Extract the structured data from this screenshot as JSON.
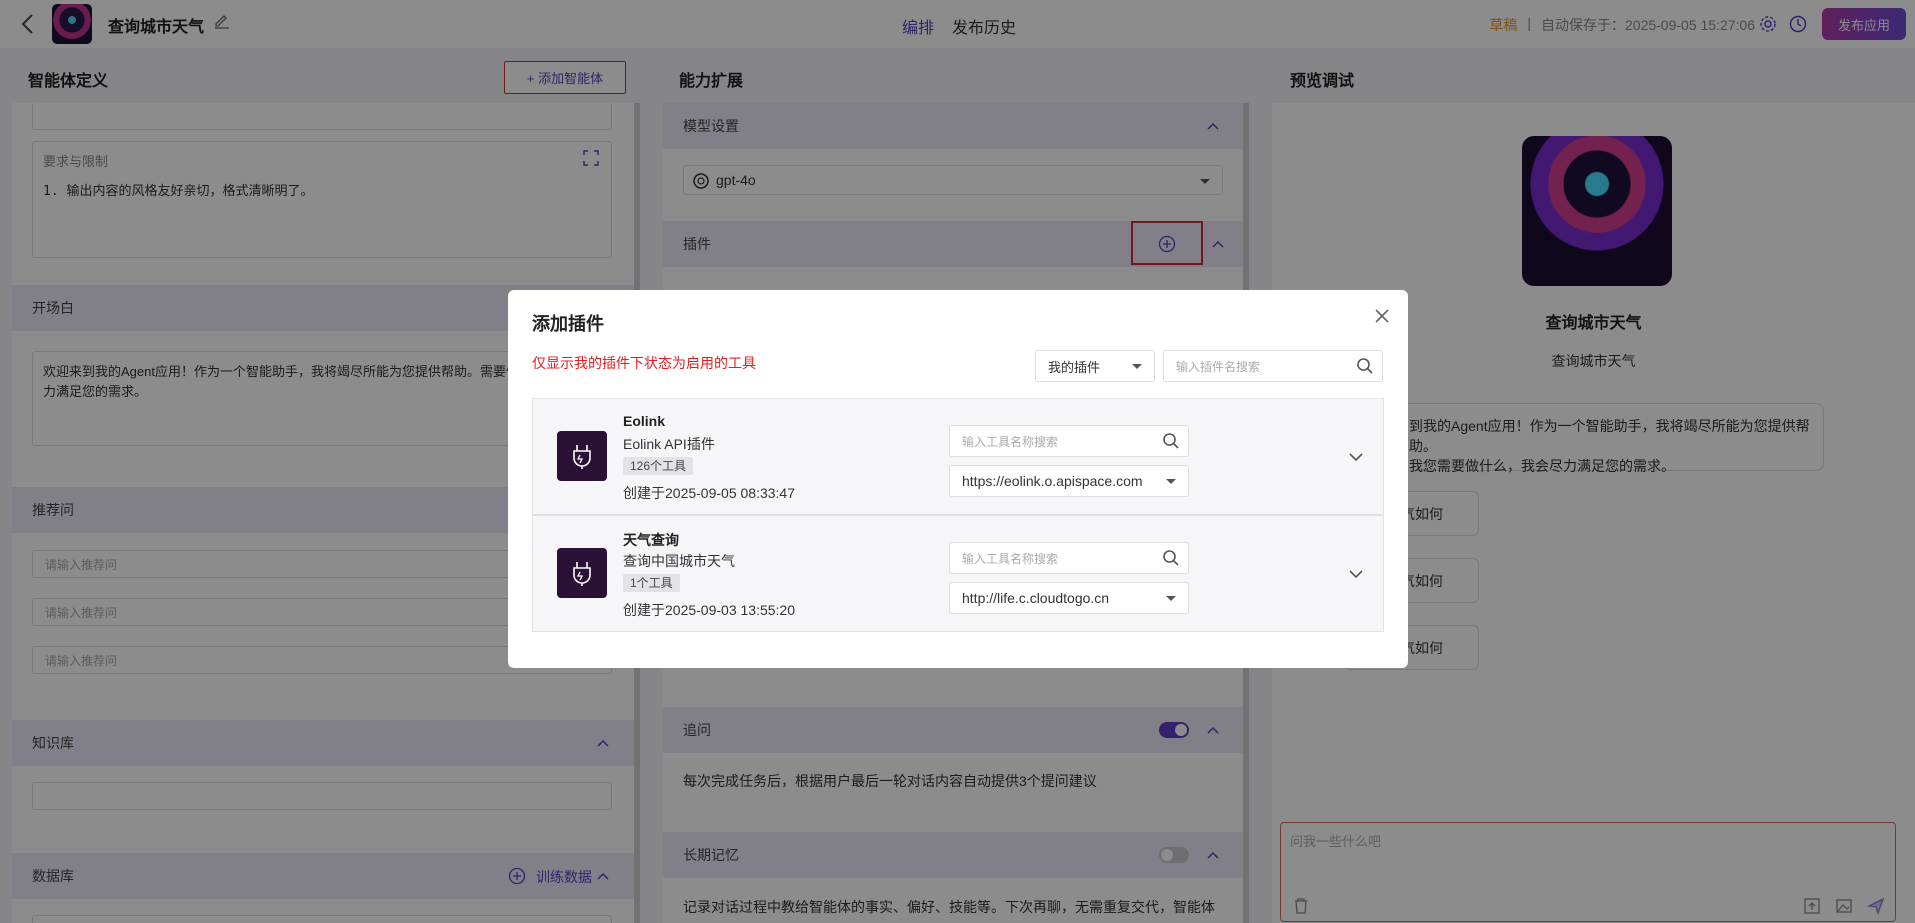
{
  "header": {
    "app_title": "查询城市天气",
    "tabs": [
      "编排",
      "发布历史"
    ],
    "draft_label": "草稿",
    "separator": "|",
    "autosave": "自动保存于：2025-09-05 15:27:06",
    "publish_label": "发布应用"
  },
  "left": {
    "title": "智能体定义",
    "add_agent_label": "添加智能体",
    "requirements_label": "要求与限制",
    "requirements_text": "1. 输出内容的风格友好亲切，格式清晰明了。",
    "opening_label": "开场白",
    "opening_text": "欢迎来到我的Agent应用！作为一个智能助手，我将竭尽所能为您提供帮助。需要做什么，我会尽力满足您的需求。",
    "suggest_label": "推荐问",
    "suggest_placeholders": [
      "请输入推荐问",
      "请输入推荐问",
      "请输入推荐问"
    ],
    "knowledge_label": "知识库",
    "database_label": "数据库",
    "train_label": "训练数据"
  },
  "middle": {
    "title": "能力扩展",
    "model_label": "模型设置",
    "model_value": "gpt-4o",
    "plugin_label": "插件",
    "followup_label": "追问",
    "followup_on": true,
    "followup_text": "每次完成任务后，根据用户最后一轮对话内容自动提供3个提问建议",
    "memory_label": "长期记忆",
    "memory_on": false,
    "memory_text": "记录对话过程中教给智能体的事实、偏好、技能等。下次再聊，无需重复交代，智能体"
  },
  "right": {
    "title": "预览调试",
    "agent_name": "查询城市天气",
    "agent_desc": "查询城市天气",
    "welcome_text_line1": "到我的Agent应用！作为一个智能助手，我将竭尽所能为您提供帮助。",
    "welcome_text_line2": "我您需要做什么，我会尽力满足您的需求。",
    "suggestions": [
      "气如何",
      "气如何",
      "气如何"
    ],
    "chat_placeholder": "问我一些什么吧"
  },
  "modal": {
    "title": "添加插件",
    "hint": "仅显示我的插件下状态为启用的工具",
    "filter_value": "我的插件",
    "search_placeholder": "输入插件名搜索",
    "plugins": [
      {
        "name": "Eolink",
        "desc": "Eolink API插件",
        "tool_count": "126个工具",
        "created": "创建于2025-09-05 08:33:47",
        "tool_search_placeholder": "输入工具名称搜索",
        "url": "https://eolink.o.apispace.com"
      },
      {
        "name": "天气查询",
        "desc": "查询中国城市天气",
        "tool_count": "1个工具",
        "created": "创建于2025-09-03 13:55:20",
        "tool_search_placeholder": "输入工具名称搜索",
        "url": "http://life.c.cloudtogo.cn"
      }
    ]
  },
  "colors": {
    "accent": "#5b3fc4",
    "section_bg": "#ebe8f7",
    "hint_red": "#e02020",
    "draft_orange": "#e39a2b",
    "highlight_red": "#d9232e"
  }
}
